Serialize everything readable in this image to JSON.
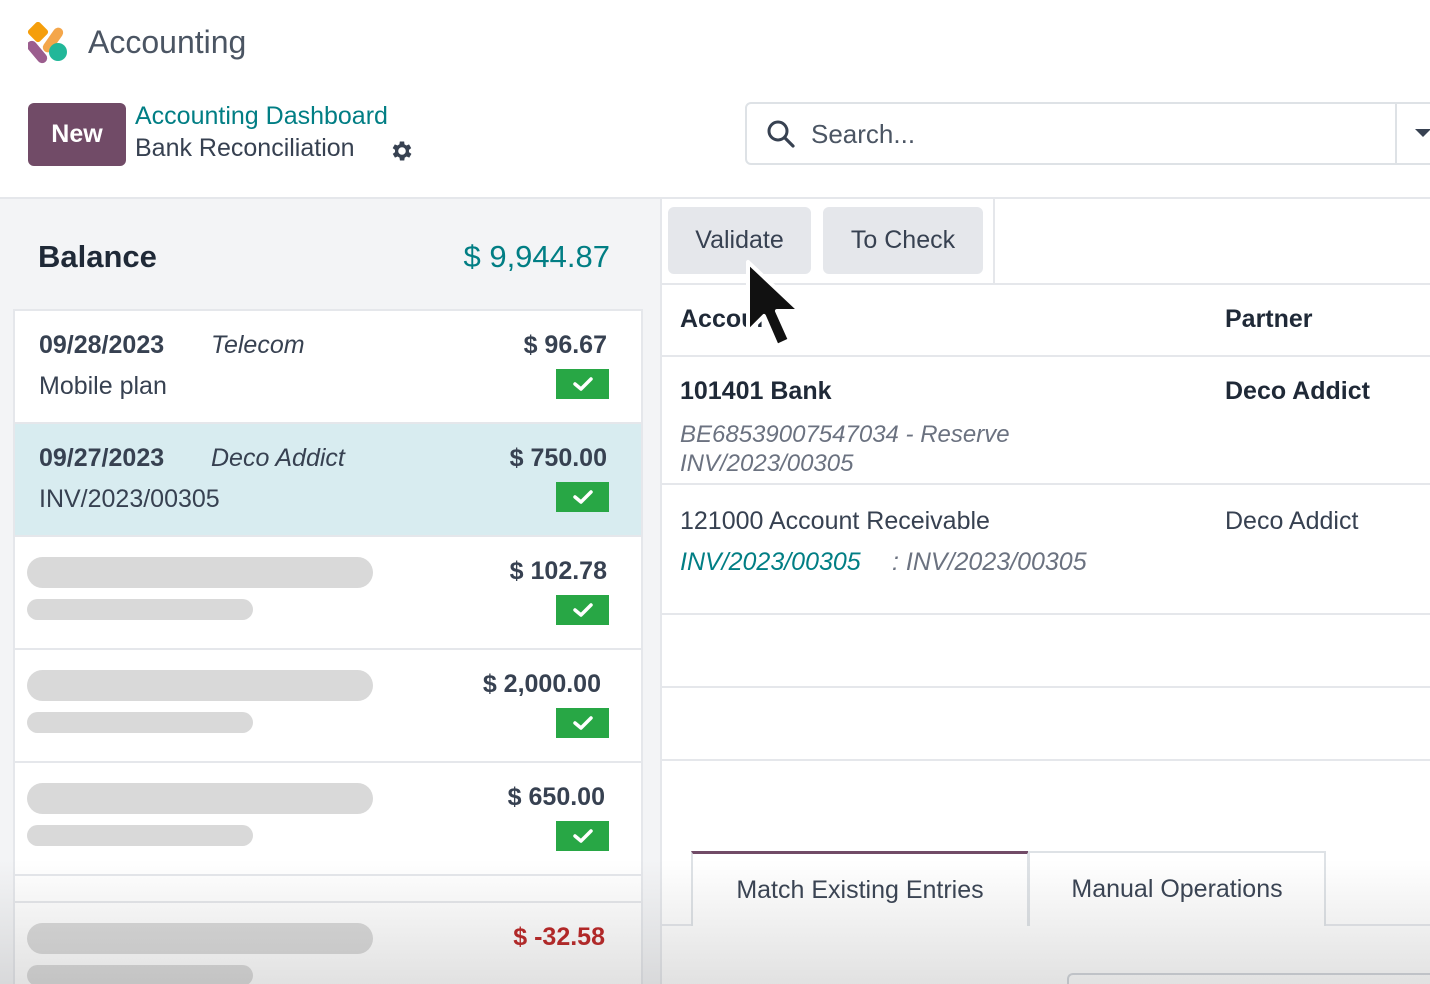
{
  "app": {
    "title": "Accounting",
    "logo_icon": "accounting-app-logo",
    "brand_color": "#714b67",
    "link_color": "#017e84"
  },
  "control_panel": {
    "new_button": "New",
    "breadcrumb_parent": "Accounting Dashboard",
    "breadcrumb_current": "Bank Reconciliation",
    "settings_icon": "gear-icon",
    "search": {
      "placeholder": "Search...",
      "icon": "search-icon",
      "toggle_icon": "caret-down-icon"
    }
  },
  "left": {
    "balance_label": "Balance",
    "balance_value": "$ 9,944.87",
    "lines": [
      {
        "date": "09/28/2023",
        "partner": "Telecom",
        "label": "Mobile plan",
        "amount": "$ 96.67",
        "checked": true,
        "selected": false,
        "loading": false
      },
      {
        "date": "09/27/2023",
        "partner": "Deco Addict",
        "label": "INV/2023/00305",
        "amount": "$ 750.00",
        "checked": true,
        "selected": true,
        "loading": false
      },
      {
        "date": "",
        "partner": "",
        "label": "",
        "amount": "$ 102.78",
        "checked": true,
        "selected": false,
        "loading": true
      },
      {
        "date": "",
        "partner": "",
        "label": "",
        "amount": "$ 2,000.00",
        "checked": true,
        "selected": false,
        "loading": true
      },
      {
        "date": "",
        "partner": "",
        "label": "",
        "amount": "$ 650.00",
        "checked": true,
        "selected": false,
        "loading": true
      },
      {
        "date": "",
        "partner": "",
        "label": "",
        "amount": "$ -32.58",
        "checked": false,
        "selected": false,
        "loading": true
      }
    ]
  },
  "right": {
    "buttons": {
      "validate": "Validate",
      "to_check": "To Check"
    },
    "columns": {
      "account": "Account",
      "partner": "Partner"
    },
    "rows": [
      {
        "account": "101401 Bank",
        "partner": "Deco Addict",
        "sub1": "BE68539007547034 - Reserve",
        "sub2": "INV/2023/00305"
      },
      {
        "account": "121000 Account Receivable",
        "partner": "Deco Addict",
        "link": "INV/2023/00305",
        "ref": ": INV/2023/00305"
      }
    ],
    "tabs": {
      "match": "Match Existing Entries",
      "manual": "Manual Operations"
    }
  }
}
